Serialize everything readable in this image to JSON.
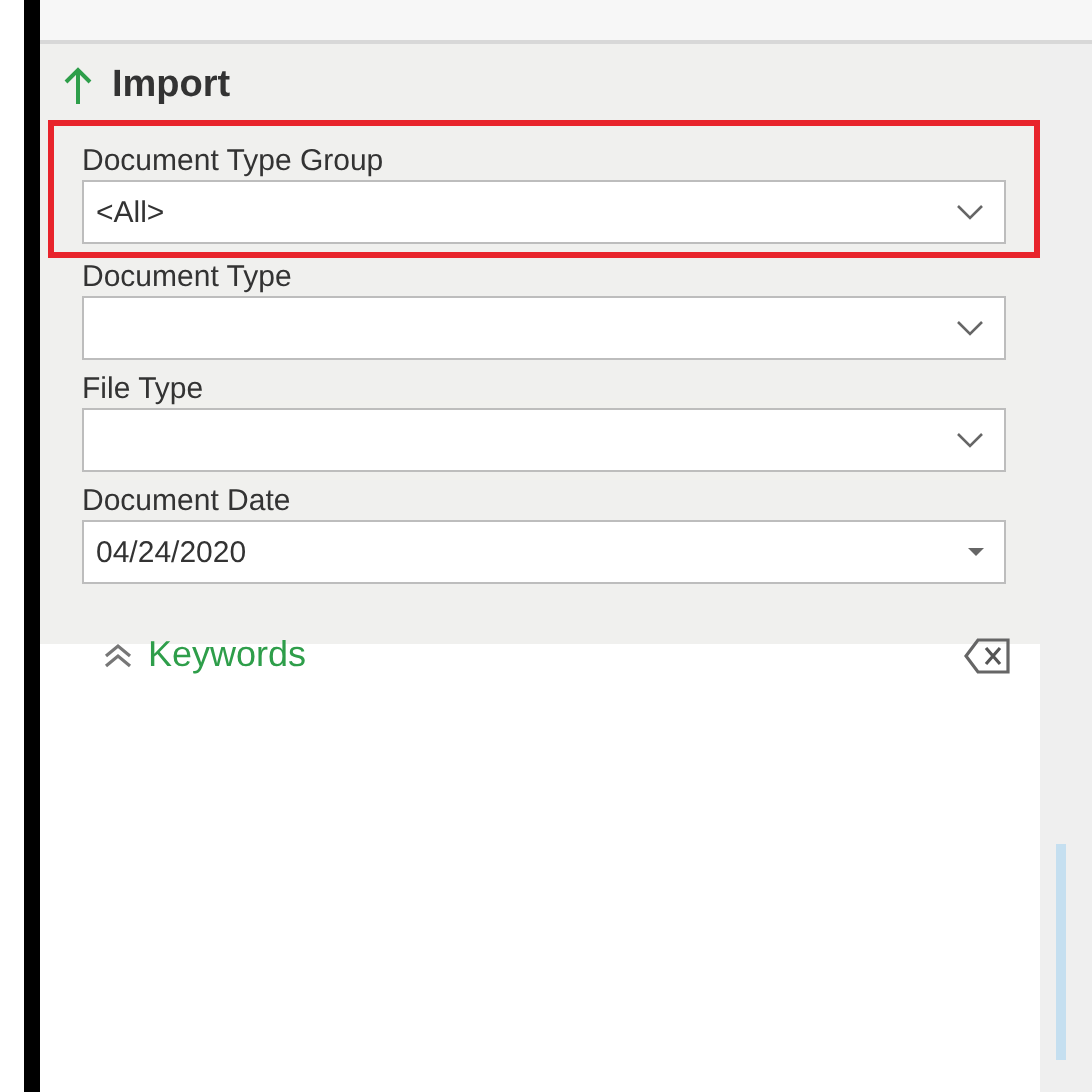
{
  "section": {
    "title": "Import"
  },
  "fields": [
    {
      "label": "Document Type Group",
      "value": "<All>",
      "kind": "dropdown",
      "highlighted": true
    },
    {
      "label": "Document Type",
      "kind": "dropdown",
      "highlighted": false
    },
    {
      "label": "File Type",
      "kind": "dropdown",
      "highlighted": false
    },
    {
      "label": "Document Date",
      "value": "04/24/2020",
      "kind": "date",
      "highlighted": false
    }
  ],
  "keywords": {
    "title": "Keywords",
    "expanded": true
  }
}
